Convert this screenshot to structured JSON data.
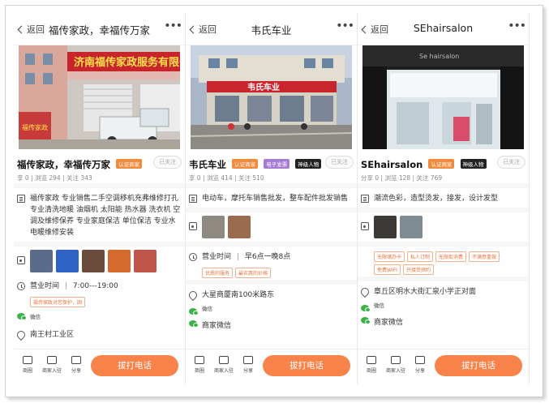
{
  "common": {
    "back_label": "返回",
    "more_label": "•••",
    "verified_badge": "认证商家",
    "follow_label": "已关注",
    "bottom_nav": [
      "商圈",
      "商家入驻",
      "分享"
    ],
    "call_label": "拔打电话",
    "wechat_label": "微信",
    "merchant_wechat_label": "商家微信"
  },
  "panels": [
    {
      "title": "福传家政，幸福传万家",
      "store_name": "福传家政，幸福传万家",
      "meta": "享 0 | 浏览  294 | 关注  343",
      "description": "福传家政 专业销售二手空调移机充弗维修打孔 专业清洗地暖 油烟机 太阳能 热水器 洗衣机 空调及维修保养 专业家庭保洁 单位保洁 专业水电暖维修安装",
      "hours_label": "营业时间",
      "hours": "7:00---19:00",
      "hours_tags": [
        "福传家政对您保护，困"
      ],
      "address": "南王村工业区",
      "sign_text": "济南福传家政服务有限公司",
      "sign_text2": "福传家政"
    },
    {
      "title": "韦氏车业",
      "store_name": "韦氏车业",
      "badges": [
        "认证商家",
        "电子发票",
        "神级人物"
      ],
      "meta": "享 0 | 浏览  414 | 关注  510",
      "description": "电动车，摩托车销售批发，整车配件批发销售",
      "hours_label": "营业时间",
      "hours": "早6点一晚8点",
      "hours_tags": [
        "优质的服务",
        "最实惠的价格"
      ],
      "address": "大星商厦南100米路东",
      "sign_text": "韦氏车业"
    },
    {
      "title": "SEhairsalon",
      "store_name": "SEhairsalon",
      "badges": [
        "认证商家",
        "神级人物"
      ],
      "meta": "分享 0 | 浏览  128 | 关注  769",
      "description": "潮流色彩，造型烫发，接发，设计发型",
      "tags": [
        "无限储办卡",
        "私人订制",
        "无限街消费",
        "不满意重做",
        "免费WIFI",
        "只接受预约"
      ],
      "address": "章丘区明水大街汇泉小学正对面",
      "sign_text": "Se hairsalon"
    }
  ]
}
